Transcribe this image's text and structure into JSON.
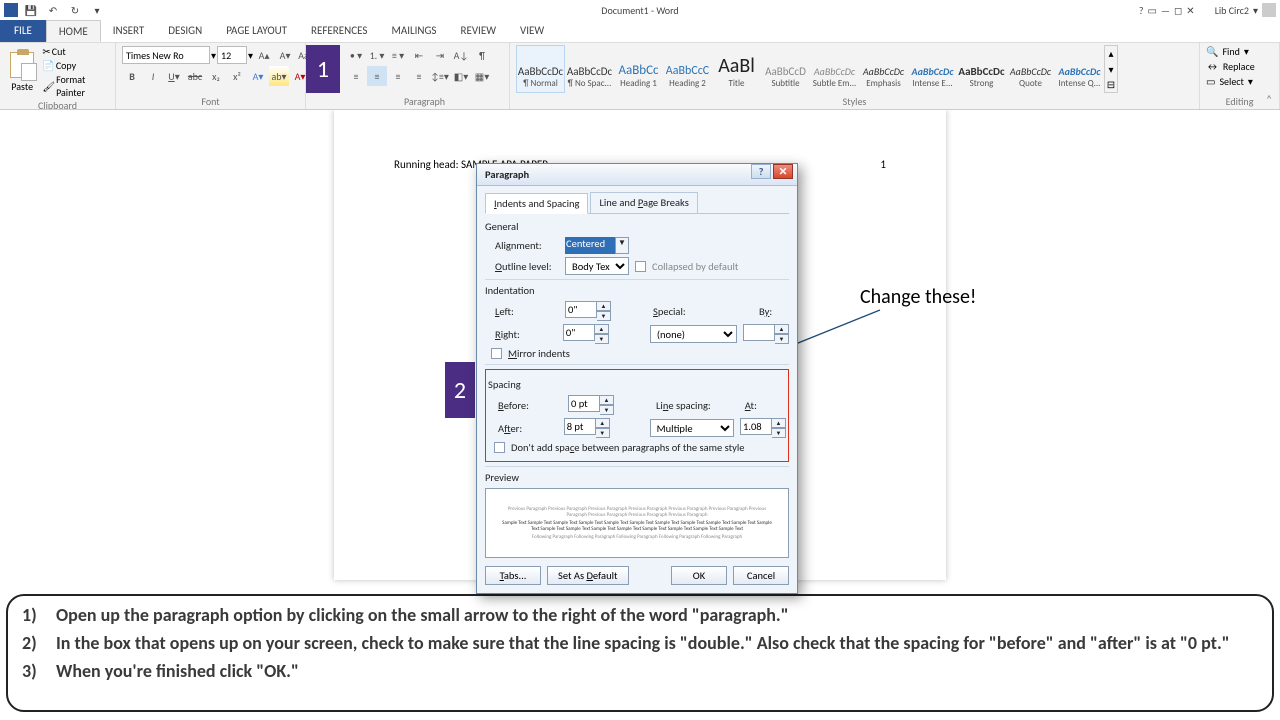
{
  "title": {
    "app": "Document1 - Word",
    "user": "Lib Circ2"
  },
  "tabs": {
    "file": "FILE",
    "home": "HOME",
    "insert": "INSERT",
    "design": "DESIGN",
    "layout": "PAGE LAYOUT",
    "references": "REFERENCES",
    "mailings": "MAILINGS",
    "review": "REVIEW",
    "view": "VIEW"
  },
  "clipboard": {
    "paste": "Paste",
    "cut": "Cut",
    "copy": "Copy",
    "fmt": "Format Painter",
    "label": "Clipboard"
  },
  "font": {
    "family": "Times New Ro",
    "size": "12",
    "label": "Font"
  },
  "paragraph": {
    "label": "Paragraph"
  },
  "styles": {
    "label": "Styles",
    "items": [
      {
        "preview": "AaBbCcDc",
        "name": "¶ Normal"
      },
      {
        "preview": "AaBbCcDc",
        "name": "¶ No Spac..."
      },
      {
        "preview": "AaBbCc",
        "name": "Heading 1"
      },
      {
        "preview": "AaBbCcC",
        "name": "Heading 2"
      },
      {
        "preview": "AaBl",
        "name": "Title"
      },
      {
        "preview": "AaBbCcD",
        "name": "Subtitle"
      },
      {
        "preview": "AaBbCcDc",
        "name": "Subtle Em..."
      },
      {
        "preview": "AaBbCcDc",
        "name": "Emphasis"
      },
      {
        "preview": "AaBbCcDc",
        "name": "Intense E..."
      },
      {
        "preview": "AaBbCcDc",
        "name": "Strong"
      },
      {
        "preview": "AaBbCcDc",
        "name": "Quote"
      },
      {
        "preview": "AaBbCcDc",
        "name": "Intense Q..."
      }
    ]
  },
  "editing": {
    "find": "Find",
    "replace": "Replace",
    "select": "Select",
    "label": "Editing"
  },
  "doc": {
    "running": "Running head: SAMPLE APA PAPER",
    "pageno": "1"
  },
  "badge1": "1",
  "badge2": "2",
  "dialog": {
    "title": "Paragraph",
    "tab1": "Indents and Spacing",
    "tab2": "Line and Page Breaks",
    "general": "General",
    "alignment_lbl": "Alignment:",
    "alignment_val": "Centered",
    "outline_lbl": "Outline level:",
    "outline_val": "Body Text",
    "collapsed": "Collapsed by default",
    "indent": "Indentation",
    "left_lbl": "Left:",
    "left_val": "0\"",
    "right_lbl": "Right:",
    "right_val": "0\"",
    "special_lbl": "Special:",
    "special_val": "(none)",
    "by_lbl": "By:",
    "by_val": "",
    "mirror": "Mirror indents",
    "spacing": "Spacing",
    "before_lbl": "Before:",
    "before_val": "0 pt",
    "after_lbl": "After:",
    "after_val": "8 pt",
    "linesp_lbl": "Line spacing:",
    "linesp_val": "Multiple",
    "at_lbl": "At:",
    "at_val": "1.08",
    "noadd": "Don't add space between paragraphs of the same style",
    "preview_lbl": "Preview",
    "prev_before": "Previous Paragraph Previous Paragraph Previous Paragraph Previous Paragraph Previous Paragraph Previous Paragraph Previous Paragraph Previous Paragraph Previous Paragraph Previous Paragraph",
    "prev_sample": "Sample Text Sample Text Sample Text Sample Text Sample Text Sample Text Sample Text Sample Text Sample Text Sample Text Sample Text Sample Text Sample Text Sample Text Sample Text Sample Text Sample Text Sample Text Sample Text",
    "prev_after": "Following Paragraph Following Paragraph Following Paragraph Following Paragraph Following Paragraph",
    "tabs_btn": "Tabs...",
    "default_btn": "Set As Default",
    "ok": "OK",
    "cancel": "Cancel"
  },
  "annotation": "Change these!",
  "instructions": {
    "i1": "Open up the paragraph option by clicking on the small arrow to the right of the word \"paragraph.\"",
    "i2": "In the box that opens up on your screen, check to make sure that the line spacing is \"double.\"  Also check that the spacing for \"before\" and \"after\" is at \"0 pt.\"",
    "i3": "When you're finished click \"OK.\""
  }
}
